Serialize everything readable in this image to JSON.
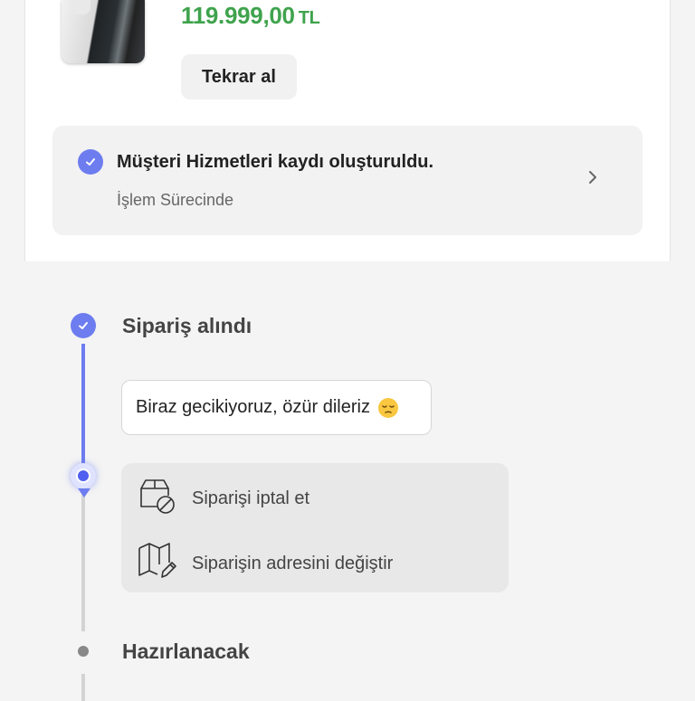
{
  "product": {
    "price": "119.999,00",
    "currency": "TL",
    "reorder_label": "Tekrar al"
  },
  "service_record": {
    "title": "Müşteri Hizmetleri kaydı oluşturuldu.",
    "status": "İşlem Sürecinde"
  },
  "timeline": {
    "steps": [
      {
        "label": "Sipariş alındı",
        "state": "done"
      },
      {
        "label": "Hazırlanacak",
        "state": "pending"
      }
    ],
    "delay_message": "Biraz gecikiyoruz, özür dileriz",
    "actions": [
      {
        "label": "Siparişi iptal et",
        "icon": "cancel-box-icon"
      },
      {
        "label": "Siparişin adresini değiştir",
        "icon": "map-edit-icon"
      }
    ]
  },
  "colors": {
    "price": "#3fa34d",
    "accent": "#6d7df0",
    "background": "#f4f4f4"
  }
}
